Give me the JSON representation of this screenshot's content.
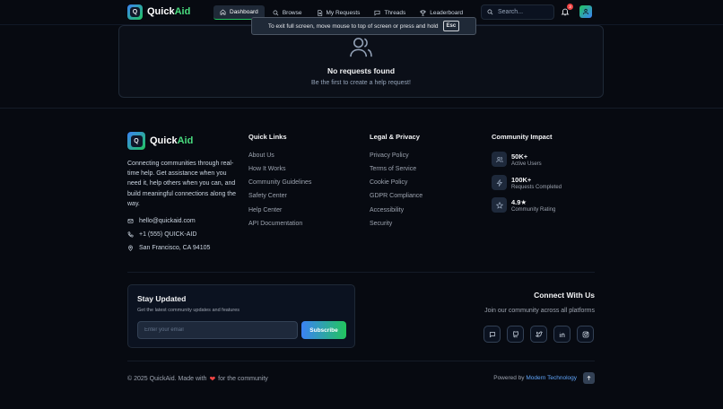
{
  "header": {
    "logo_letter": "Q",
    "brand_first": "Quick",
    "brand_second": "Aid",
    "nav": [
      {
        "label": "Dashboard",
        "icon": "home-icon",
        "active": true
      },
      {
        "label": "Browse",
        "icon": "search-icon",
        "active": false
      },
      {
        "label": "My Requests",
        "icon": "document-icon",
        "active": false
      },
      {
        "label": "Threads",
        "icon": "chat-icon",
        "active": false
      },
      {
        "label": "Leaderboard",
        "icon": "trophy-icon",
        "active": false
      }
    ],
    "search_placeholder": "Search...",
    "notification_count": "3"
  },
  "toast": {
    "message": "To exit full screen, move mouse to top of screen or press and hold",
    "key": "Esc"
  },
  "empty_state": {
    "icon": "users-icon",
    "title": "No requests found",
    "subtitle": "Be the first to create a help request!"
  },
  "footer": {
    "brand": {
      "description": "Connecting communities through real-time help. Get assistance when you need it, help others when you can, and build meaningful connections along the way.",
      "email": "hello@quickaid.com",
      "phone": "+1 (555) QUICK-AID",
      "address": "San Francisco, CA 94105"
    },
    "quick_links": {
      "title": "Quick Links",
      "items": [
        "About Us",
        "How It Works",
        "Community Guidelines",
        "Safety Center",
        "Help Center",
        "API Documentation"
      ]
    },
    "legal": {
      "title": "Legal & Privacy",
      "items": [
        "Privacy Policy",
        "Terms of Service",
        "Cookie Policy",
        "GDPR Compliance",
        "Accessibility",
        "Security"
      ]
    },
    "impact": {
      "title": "Community Impact",
      "items": [
        {
          "value": "50K+",
          "label": "Active Users",
          "icon": "users-icon"
        },
        {
          "value": "100K+",
          "label": "Requests Completed",
          "icon": "lightning-icon"
        },
        {
          "value": "4.9★",
          "label": "Community Rating",
          "icon": "star-icon"
        }
      ]
    },
    "newsletter": {
      "title": "Stay Updated",
      "subtitle": "Get the latest community updates and features",
      "placeholder": "Enter your email",
      "button": "Subscribe"
    },
    "connect": {
      "title": "Connect With Us",
      "subtitle": "Join our community across all platforms",
      "socials": [
        "discord-icon",
        "github-icon",
        "twitter-icon",
        "linkedin-icon",
        "instagram-icon"
      ]
    },
    "copyright_pre": "© 2025 QuickAid. Made with",
    "copyright_post": "for the community",
    "powered_pre": "Powered by",
    "powered_highlight": "Modern Technology"
  },
  "colors": {
    "background": "#070a11",
    "accent_green": "#22c55e",
    "accent_blue": "#3b82f6",
    "badge_red": "#ef4444"
  }
}
